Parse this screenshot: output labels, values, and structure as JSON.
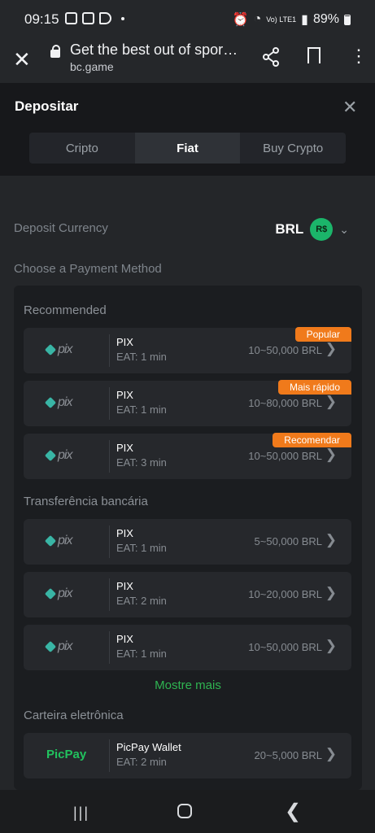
{
  "status_bar": {
    "time": "09:15",
    "network": "Vo) LTE1",
    "battery": "89%"
  },
  "browser": {
    "title": "Get the best out of spor…",
    "url": "bc.game"
  },
  "modal": {
    "title": "Depositar",
    "tabs": [
      "Cripto",
      "Fiat",
      "Buy Crypto"
    ],
    "active_tab": "Fiat"
  },
  "deposit": {
    "currency_label": "Deposit Currency",
    "currency_code": "BRL",
    "currency_symbol": "R$",
    "payment_label": "Choose a Payment Method"
  },
  "sections": {
    "recommended": "Recommended",
    "bank": "Transferência bancária",
    "wallet": "Carteira eletrônica",
    "show_more": "Mostre mais"
  },
  "methods": [
    {
      "logo": "pix",
      "name": "PIX",
      "eat": "EAT: 1 min",
      "range": "10~50,000 BRL",
      "tag": "Popular"
    },
    {
      "logo": "pix",
      "name": "PIX",
      "eat": "EAT: 1 min",
      "range": "10~80,000 BRL",
      "tag": "Mais rápido"
    },
    {
      "logo": "pix",
      "name": "PIX",
      "eat": "EAT: 3 min",
      "range": "10~50,000 BRL",
      "tag": "Recomendar"
    },
    {
      "logo": "pix",
      "name": "PIX",
      "eat": "EAT: 1 min",
      "range": "5~50,000 BRL"
    },
    {
      "logo": "pix",
      "name": "PIX",
      "eat": "EAT: 2 min",
      "range": "10~20,000 BRL"
    },
    {
      "logo": "pix",
      "name": "PIX",
      "eat": "EAT: 1 min",
      "range": "10~50,000 BRL"
    },
    {
      "logo": "PicPay",
      "name": "PicPay Wallet",
      "eat": "EAT: 2 min",
      "range": "20~5,000 BRL"
    }
  ],
  "colors": {
    "accent_green": "#2fb451",
    "tag_orange": "#f07a1b",
    "currency_badge": "#1bb56a"
  }
}
